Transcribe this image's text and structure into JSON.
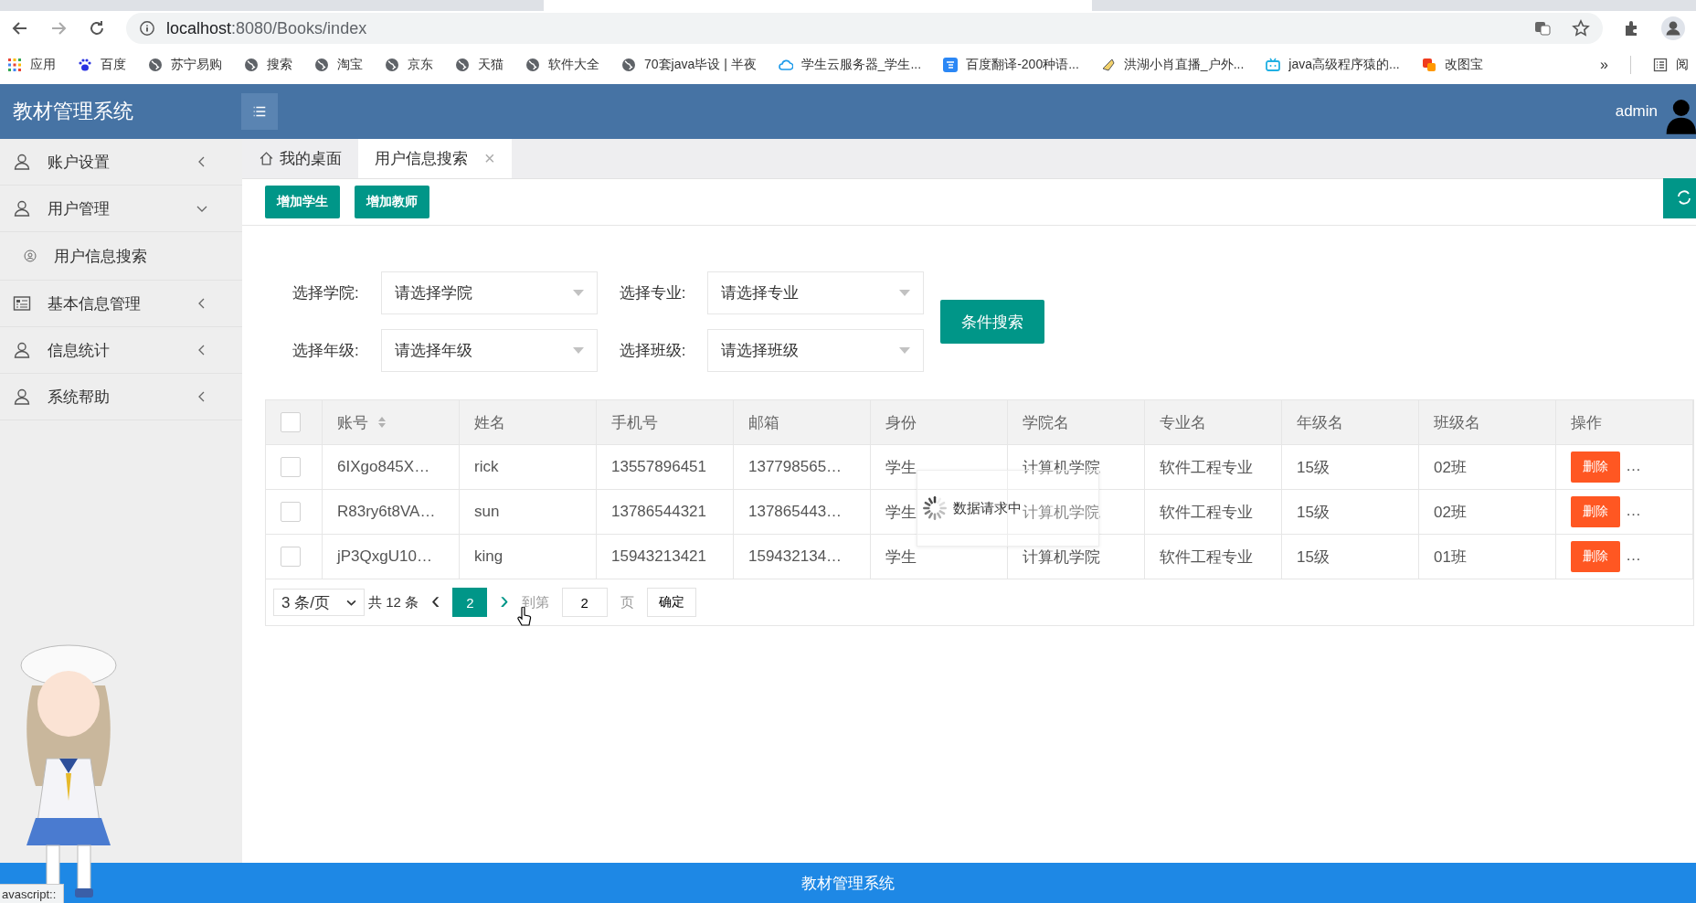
{
  "browser": {
    "url_host": "localhost",
    "url_path": ":8080/Books/index",
    "bookmarks": [
      {
        "kind": "apps",
        "label": "应用"
      },
      {
        "kind": "paw",
        "label": "百度"
      },
      {
        "kind": "globe",
        "label": "苏宁易购"
      },
      {
        "kind": "globe",
        "label": "搜索"
      },
      {
        "kind": "globe",
        "label": "淘宝"
      },
      {
        "kind": "globe",
        "label": "京东"
      },
      {
        "kind": "globe",
        "label": "天猫"
      },
      {
        "kind": "globe",
        "label": "软件大全"
      },
      {
        "kind": "globe",
        "label": "70套java毕设 | 半夜"
      },
      {
        "kind": "cloud",
        "label": "学生云服务器_学生..."
      },
      {
        "kind": "translate",
        "label": "百度翻译-200种语..."
      },
      {
        "kind": "bird",
        "label": "洪湖小肖直播_户外..."
      },
      {
        "kind": "tv",
        "label": "java高级程序猿的..."
      },
      {
        "kind": "squares",
        "label": "改图宝"
      }
    ],
    "more": "»",
    "reading_list": "阅",
    "status_text": "avascript::"
  },
  "app": {
    "title": "教材管理系统",
    "user": "admin",
    "footer": "教材管理系统"
  },
  "sidebar": {
    "items": [
      {
        "kind": "user",
        "label": "账户设置",
        "expanded": false
      },
      {
        "kind": "user",
        "label": "用户管理",
        "expanded": true,
        "children": [
          {
            "label": "用户信息搜索"
          }
        ]
      },
      {
        "kind": "card",
        "label": "基本信息管理",
        "expanded": false
      },
      {
        "kind": "user",
        "label": "信息统计",
        "expanded": false
      },
      {
        "kind": "user",
        "label": "系统帮助",
        "expanded": false
      }
    ]
  },
  "tabs": [
    {
      "kind": "home",
      "label": "我的桌面",
      "selected": false
    },
    {
      "kind": "closable",
      "label": "用户信息搜索",
      "selected": true,
      "close": "×"
    }
  ],
  "toolbar": {
    "buttons": [
      "增加学生",
      "增加教师"
    ]
  },
  "filters": [
    {
      "label": "选择学院:",
      "placeholder": "请选择学院"
    },
    {
      "label": "选择专业:",
      "placeholder": "请选择专业"
    },
    {
      "label": "选择年级:",
      "placeholder": "请选择年级"
    },
    {
      "label": "选择班级:",
      "placeholder": "请选择班级"
    }
  ],
  "search_button": "条件搜索",
  "table": {
    "header_checked": false,
    "columns": [
      "账号",
      "姓名",
      "手机号",
      "邮箱",
      "身份",
      "学院名",
      "专业名",
      "年级名",
      "班级名",
      "操作"
    ],
    "rows": [
      {
        "checked": false,
        "cells": [
          "6IXgo845X…",
          "rick",
          "13557896451",
          "137798565…",
          "学生",
          "计算机学院",
          "软件工程专业",
          "15级",
          "02班"
        ],
        "action": "删除",
        "more": "…"
      },
      {
        "checked": false,
        "cells": [
          "R83ry6t8VA…",
          "sun",
          "13786544321",
          "137865443…",
          "学生",
          "计算机学院",
          "软件工程专业",
          "15级",
          "02班"
        ],
        "action": "删除",
        "more": "…"
      },
      {
        "checked": false,
        "cells": [
          "jP3QxgU10…",
          "king",
          "15943213421",
          "159432134…",
          "学生",
          "计算机学院",
          "软件工程专业",
          "15级",
          "01班"
        ],
        "action": "删除",
        "more": "…"
      }
    ]
  },
  "loading": {
    "text": "数据请求中"
  },
  "pagination": {
    "page_size": "3 条/页",
    "total": "共 12 条",
    "pages": [
      {
        "label": "2",
        "selected": true
      }
    ],
    "prev": "‹",
    "next": "›",
    "goto_label": "到第",
    "goto_value": "2",
    "page_unit": "页",
    "confirm": "确定"
  }
}
